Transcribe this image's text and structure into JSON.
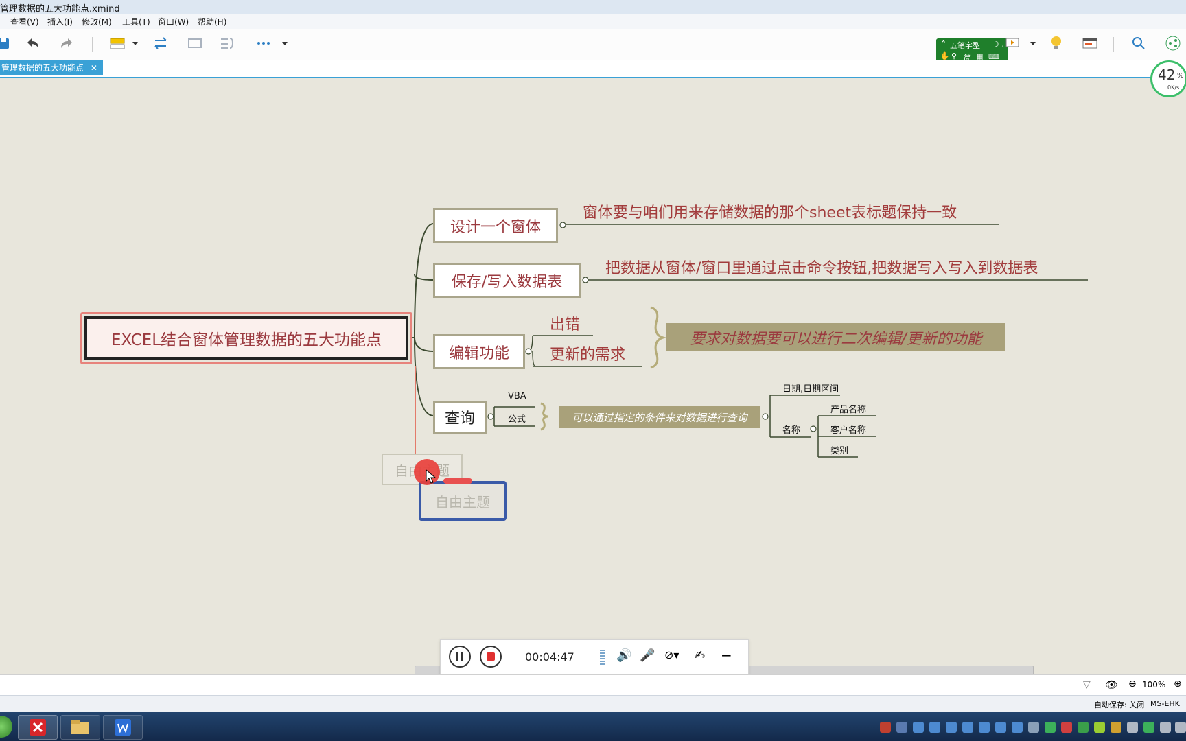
{
  "window": {
    "title": "管理数据的五大功能点.xmind"
  },
  "menu": [
    "查看(V)",
    "插入(I)",
    "修改(M)",
    "工具(T)",
    "窗口(W)",
    "帮助(H)"
  ],
  "tab": {
    "label": "管理数据的五大功能点",
    "close": "✕"
  },
  "ime": {
    "line1": "五笔字型",
    "line2": "简"
  },
  "network": {
    "percent": "42",
    "pct_sign": "%",
    "speed": "0K/s"
  },
  "mindmap": {
    "central": "EXCEL结合窗体管理数据的五大功能点",
    "branches": [
      {
        "label": "设计一个窗体",
        "note": "窗体要与咱们用来存储数据的那个sheet表标题保持一致"
      },
      {
        "label": "保存/写入数据表",
        "note": "把数据从窗体/窗口里通过点击命令按钮,把数据写入写入到数据表"
      },
      {
        "label": "编辑功能",
        "children": [
          "出错",
          "更新的需求"
        ],
        "summary": "要求对数据要可以进行二次编辑/更新的功能"
      },
      {
        "label": "查询",
        "children": [
          "VBA",
          "公式"
        ],
        "summary": "可以通过指定的条件来对数据进行查询",
        "sub": {
          "date": "日期,日期区间",
          "name": "名称",
          "name_items": [
            "产品名称",
            "客户名称",
            "类别"
          ]
        }
      }
    ],
    "free_topic_ghost": "自由主题",
    "free_topic": "自由主题"
  },
  "recorder": {
    "time": "00:04:47"
  },
  "status": {
    "zoom": "100%",
    "autosave": "自动保存: 关闭",
    "user": "MS-EHK"
  },
  "colors": {
    "accent": "#3aa1d6",
    "topic_text": "#9b3a3f",
    "summary_bg": "#a9a17a"
  }
}
